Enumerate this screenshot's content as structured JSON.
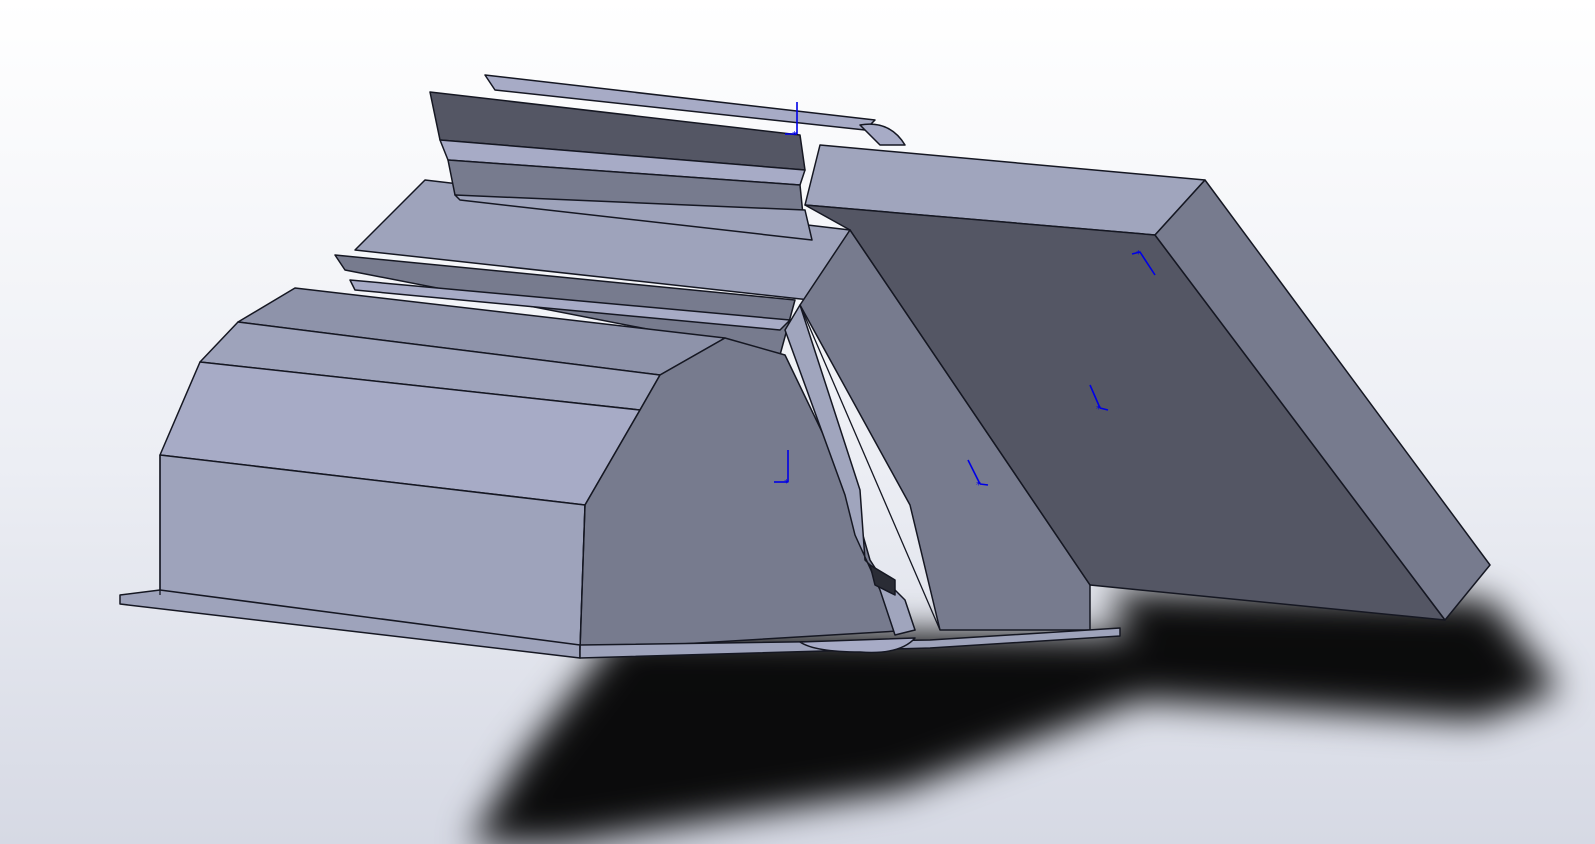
{
  "viewport": {
    "background_top": "#ffffff",
    "background_bottom": "#d6d9e4",
    "model_colors": {
      "light": "#a7abc6",
      "mid": "#9ea3bb",
      "dark": "#777b8e",
      "darker": "#545664",
      "edge": "#151722",
      "shadow": "#000000"
    },
    "triad_color": "#0000e6",
    "triad_icons": [
      "coordinate-triad-icon",
      "coordinate-triad-icon",
      "coordinate-triad-icon",
      "coordinate-triad-icon",
      "coordinate-triad-icon"
    ]
  }
}
